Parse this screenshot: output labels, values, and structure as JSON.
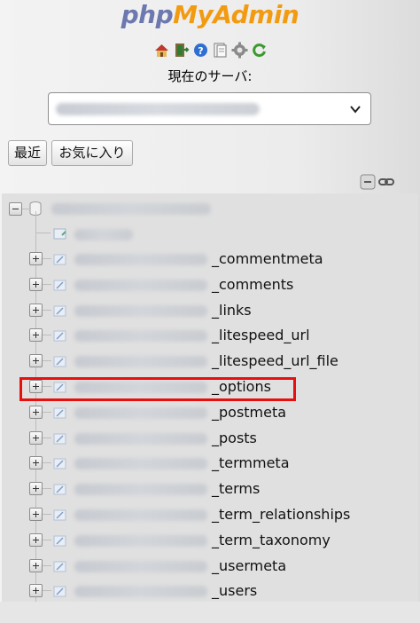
{
  "logo": {
    "php": "php",
    "my": "My",
    "admin": "Admin"
  },
  "server": {
    "label": "現在のサーバ:",
    "selected": ""
  },
  "buttons": {
    "recent": "最近",
    "favorites": "お気に入り"
  },
  "tree": {
    "items": [
      {
        "suffix": "_commentmeta"
      },
      {
        "suffix": "_comments"
      },
      {
        "suffix": "_links"
      },
      {
        "suffix": "_litespeed_url"
      },
      {
        "suffix": "_litespeed_url_file"
      },
      {
        "suffix": "_options"
      },
      {
        "suffix": "_postmeta"
      },
      {
        "suffix": "_posts"
      },
      {
        "suffix": "_termmeta"
      },
      {
        "suffix": "_terms"
      },
      {
        "suffix": "_term_relationships"
      },
      {
        "suffix": "_term_taxonomy"
      },
      {
        "suffix": "_usermeta"
      },
      {
        "suffix": "_users"
      }
    ]
  },
  "colors": {
    "highlight": "#e8100f",
    "logo_php": "#6c78af",
    "logo_myadmin": "#f29b11"
  },
  "icons": [
    "home-icon",
    "exit-icon",
    "help-icon",
    "docs-icon",
    "settings-icon",
    "reload-icon",
    "collapse-all-icon",
    "link-icon",
    "database-icon",
    "new-table-icon",
    "table-icon"
  ]
}
